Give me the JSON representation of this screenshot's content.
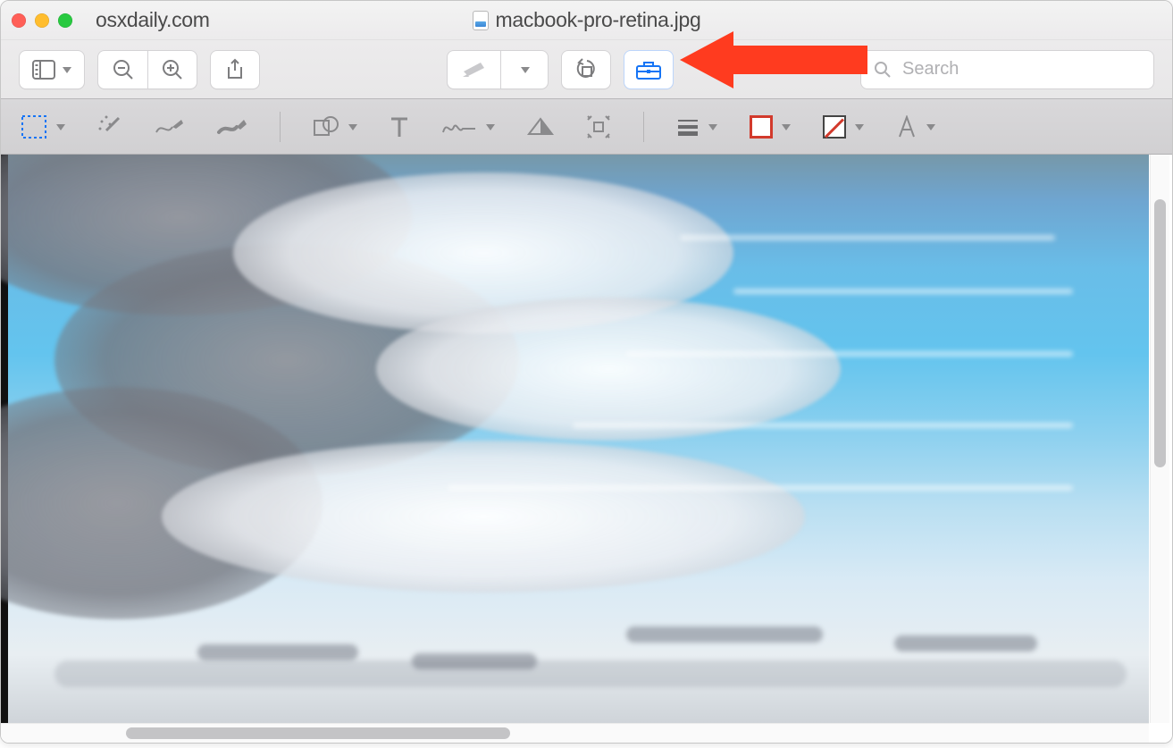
{
  "window": {
    "site_label": "osxdaily.com",
    "document_title": "macbook-pro-retina.jpg"
  },
  "toolbar": {
    "sidebar_icon": "sidebar",
    "zoom_out_icon": "zoom-out",
    "zoom_in_icon": "zoom-in",
    "share_icon": "share",
    "highlight_icon": "highlight",
    "rotate_icon": "rotate-left",
    "markup_toolbox_icon": "toolbox",
    "search_placeholder": "Search"
  },
  "markup": {
    "selection_icon": "selection-rect",
    "instant_alpha_icon": "magic-wand",
    "draw_icon": "draw",
    "sketch_icon": "sketch",
    "shapes_icon": "shapes",
    "text_icon": "text",
    "sign_icon": "signature",
    "adjust_color_icon": "adjust-color",
    "adjust_size_icon": "adjust-size",
    "line_style_icon": "line-style",
    "border_color": "#d23a2c",
    "fill_color": "none",
    "font_style_icon": "font-style"
  },
  "annotation": {
    "arrow_color": "#ff3b1f"
  }
}
